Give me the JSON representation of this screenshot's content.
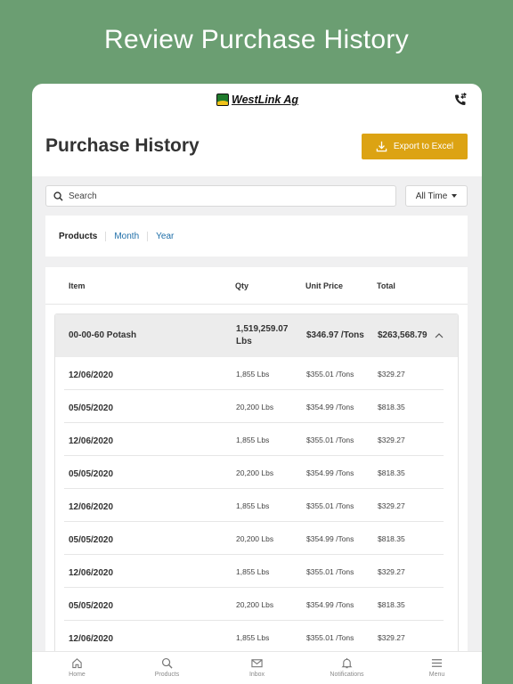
{
  "promo": {
    "headline": "Review Purchase History"
  },
  "topbar": {
    "logo_text": "WestLink Ag",
    "phone_icon": "phone-transfer-icon"
  },
  "header": {
    "title": "Purchase History",
    "export_label": "Export to Excel"
  },
  "search": {
    "placeholder": "Search",
    "time_filter": "All Time"
  },
  "tabs": [
    {
      "label": "Products",
      "active": true
    },
    {
      "label": "Month",
      "active": false
    },
    {
      "label": "Year",
      "active": false
    }
  ],
  "table": {
    "columns": {
      "item": "Item",
      "qty": "Qty",
      "unit_price": "Unit Price",
      "total": "Total"
    },
    "group": {
      "item": "00-00-60 Potash",
      "qty_line1": "1,519,259.07",
      "qty_line2": "Lbs",
      "unit_price": "$346.97 /Tons",
      "total": "$263,568.79"
    },
    "rows": [
      {
        "date": "12/06/2020",
        "qty": "1,855 Lbs",
        "unit_price": "$355.01 /Tons",
        "total": "$329.27"
      },
      {
        "date": "05/05/2020",
        "qty": "20,200 Lbs",
        "unit_price": "$354.99 /Tons",
        "total": "$818.35"
      },
      {
        "date": "12/06/2020",
        "qty": "1,855 Lbs",
        "unit_price": "$355.01 /Tons",
        "total": "$329.27"
      },
      {
        "date": "05/05/2020",
        "qty": "20,200 Lbs",
        "unit_price": "$354.99 /Tons",
        "total": "$818.35"
      },
      {
        "date": "12/06/2020",
        "qty": "1,855 Lbs",
        "unit_price": "$355.01 /Tons",
        "total": "$329.27"
      },
      {
        "date": "05/05/2020",
        "qty": "20,200 Lbs",
        "unit_price": "$354.99 /Tons",
        "total": "$818.35"
      },
      {
        "date": "12/06/2020",
        "qty": "1,855 Lbs",
        "unit_price": "$355.01 /Tons",
        "total": "$329.27"
      },
      {
        "date": "05/05/2020",
        "qty": "20,200 Lbs",
        "unit_price": "$354.99 /Tons",
        "total": "$818.35"
      },
      {
        "date": "12/06/2020",
        "qty": "1,855 Lbs",
        "unit_price": "$355.01 /Tons",
        "total": "$329.27"
      }
    ]
  },
  "nav": [
    {
      "label": "Home",
      "icon": "home-icon"
    },
    {
      "label": "Products",
      "icon": "search-icon"
    },
    {
      "label": "Inbox",
      "icon": "mail-icon"
    },
    {
      "label": "Notifications",
      "icon": "bell-icon"
    },
    {
      "label": "Menu",
      "icon": "hamburger-icon"
    }
  ],
  "colors": {
    "background": "#6b9e72",
    "accent": "#dca313",
    "link": "#1e6ea8"
  }
}
